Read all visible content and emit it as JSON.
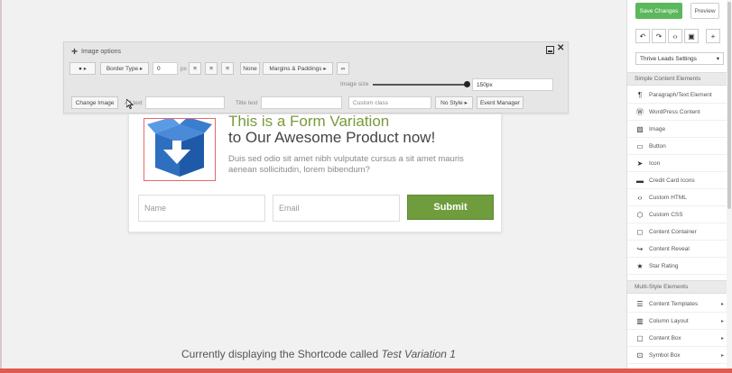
{
  "toolbar": {
    "title": "Image options",
    "border_type": "Border Type",
    "border_width": "0",
    "border_unit": "px",
    "none_label": "None",
    "margins_label": "Margins & Paddings",
    "image_size_label": "Image size",
    "image_size_value": "150px",
    "change_image": "Change Image",
    "alt_label": "Alt text",
    "title_label": "Title text",
    "custom_class": "Custom class",
    "no_style": "No Style",
    "event_manager": "Event Manager"
  },
  "card": {
    "title_line1": "This is a Form Variation",
    "title_line2": "to Our Awesome Product now!",
    "description": "Duis sed odio sit amet nibh vulputate cursus a sit amet mauris aenean sollicitudin, lorem bibendum?",
    "name_placeholder": "Name",
    "email_placeholder": "Email",
    "submit_label": "Submit"
  },
  "caption": {
    "prefix": "Currently displaying the Shortcode called",
    "name": "Test Variation 1"
  },
  "panel": {
    "save_label": "Save Changes",
    "preview_label": "Preview",
    "settings_select": "Thrive Leads Settings",
    "simple_header": "Simple Content Elements",
    "simple_items": [
      {
        "label": "Paragraph/Text Element",
        "icon": "paragraph-icon"
      },
      {
        "label": "WordPress Content",
        "icon": "wordpress-icon"
      },
      {
        "label": "Image",
        "icon": "image-icon"
      },
      {
        "label": "Button",
        "icon": "button-icon"
      },
      {
        "label": "Icon",
        "icon": "rocket-icon"
      },
      {
        "label": "Credit Card Icons",
        "icon": "credit-card-icon"
      },
      {
        "label": "Custom HTML",
        "icon": "code-icon"
      },
      {
        "label": "Custom CSS",
        "icon": "css-icon"
      },
      {
        "label": "Content Container",
        "icon": "container-icon"
      },
      {
        "label": "Content Reveal",
        "icon": "reveal-icon"
      },
      {
        "label": "Star Rating",
        "icon": "star-icon"
      }
    ],
    "multi_header": "Multi-Style Elements",
    "multi_items": [
      {
        "label": "Content Templates",
        "icon": "templates-icon"
      },
      {
        "label": "Column Layout",
        "icon": "columns-icon"
      },
      {
        "label": "Content Box",
        "icon": "box-icon"
      },
      {
        "label": "Symbol Box",
        "icon": "symbol-box-icon"
      }
    ]
  },
  "colors": {
    "accent_green": "#6f9c3c",
    "save_green": "#5cb85c",
    "title_green": "#7a9a3a"
  }
}
